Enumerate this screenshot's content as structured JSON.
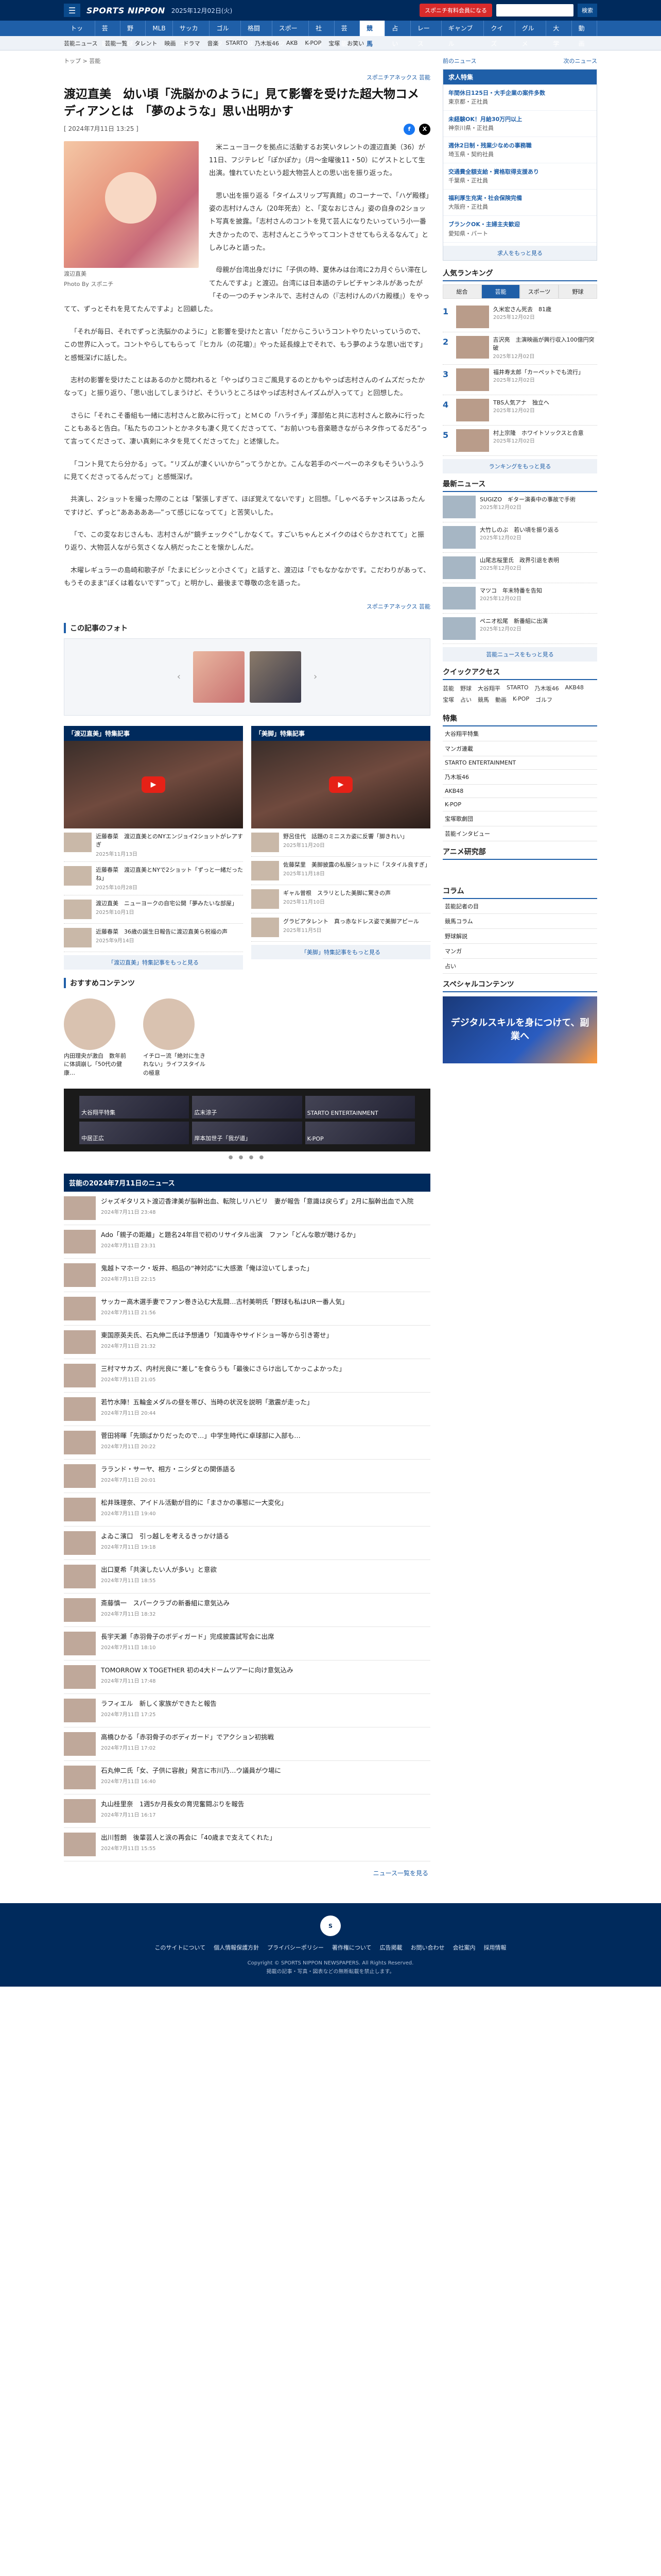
{
  "header": {
    "logo": "SPORTS NIPPON",
    "date": "2025年12月02日(火)",
    "register": "スポニチ有料会員になる",
    "search_btn": "検索"
  },
  "nav": [
    "トップ",
    "芸能",
    "野球",
    "MLB",
    "サッカー",
    "ゴルフ",
    "格闘技",
    "スポーツ",
    "社会",
    "芸能",
    "競馬",
    "占い",
    "レース",
    "ギャンブル",
    "クイズ",
    "グルメ",
    "大学",
    "動画"
  ],
  "subnav": [
    "芸能ニュース",
    "芸能一覧",
    "タレント",
    "映画",
    "ドラマ",
    "音楽",
    "STARTO",
    "乃木坂46",
    "AKB",
    "K-POP",
    "宝塚",
    "お笑い"
  ],
  "breadcrumb": "トップ > 芸能",
  "article": {
    "source": "スポニチアネックス 芸能",
    "title": "渡辺直美　幼い頃「洗脳かのように」見て影響を受けた超大物コメディアンとは　「夢のような」思い出明かす",
    "date": "[ 2024年7月11日 13:25 ]",
    "photo_caption": "渡辺直美",
    "photo_credit": "Photo By スポニチ",
    "paragraphs": [
      "米ニューヨークを拠点に活動するお笑いタレントの渡辺直美（36）が11日、フジテレビ「ぽかぽか」（月～金曜後11・50）にゲストとして生出演。憧れていたという超大物芸人との思い出を振り返った。",
      "思い出を振り返る「タイムスリップ写真館」のコーナーで、「ハゲ殿様」姿の志村けんさん（20年死去）と、「変なおじさん」姿の自身の2ショット写真を披露。「志村さんのコントを見て芸人になりたいっていう小一番大きかったので、志村さんとこうやってコントさせてもらえるなんて」としみじみと語った。",
      "母親が台湾出身だけに「子供の時、夏休みは台湾に2カ月ぐらい滞在してたんですよ」と渡辺。台湾には日本語のテレビチャンネルがあったが「その一つのチャンネルで、志村さんの（『志村けんのバカ殿様』）をやってて、ずっとそれを見てたんですよ」と回顧した。",
      "「それが毎日、それでずっと洗脳かのように」と影響を受けたと言い「だからこういうコントやりたいっていうので、この世界に入って。コントやらしてもらって『ヒカル（の花壇）』やった延長線上でそれで、もう夢のような思い出です」と感慨深げに話した。",
      "志村の影響を受けたことはあるのかと問われると「やっぱりコミご風見するのとかもやっぱ志村さんのイムズだったかなって」と振り返り、「思い出してしまうけど、そういうところはやっぱ志村さんイズムが入ってて」と回想した。",
      "さらに「それこそ番組も一緒に志村さんと飲みに行って」とＭＣの「ハライチ」澤部佑と共に志村さんと飲みに行ったこともあると告白。「私たちのコントとかネタも凄く見てくださってて、“お前いつも音楽聴きながらネタ作ってるだろ”って言ってくださって、凄い真剣にネタを見てくださってた」と述懐した。",
      "「コント見てたら分かる」って。“リズムが凄くいいから”ってうかとか。こんな若手のペーペーのネタもそういうふうに見てくださってるんだって」と感慨深げ。",
      "共演し、2ショットを撮った際のことは「緊張しすぎて、ほぼ覚えてないです」と回想。「しゃべるチャンスはあったんですけど、ずっと“あああああ―”って感じになってて」と苦笑いした。",
      "「で、この変なおじさんも、志村さんが“鏡チェックぐ”しかなくて。すごいちゃんとメイクのはぐらかされてて」と振り返り、大物芸人ながら気さくな人柄だったことを懐かしんだ。",
      "木曜レギュラーの島崎和歌子が「たまにビシッと小さくて」と話すと、渡辺は「でもなかなかです。こだわりがあって、もうそのまま“ぼくは着ないです”って」と明かし、最後まで尊敬の念を語った。"
    ],
    "footer_source": "スポニチアネックス 芸能"
  },
  "gallery": {
    "title": "この記事のフォト"
  },
  "twocol": [
    {
      "head": "「渡辺直美」特集記事",
      "items": [
        {
          "title": "近藤春菜　渡辺直美とのNYエンジョイ2ショットがレアすぎ",
          "date": "2025年11月13日"
        },
        {
          "title": "近藤春菜　渡辺直美とNYで2ショット「ずっと一緒だったね」",
          "date": "2025年10月28日"
        },
        {
          "title": "渡辺直美　ニューヨークの自宅公開「夢みたいな部屋」",
          "date": "2025年10月1日"
        },
        {
          "title": "近藤春菜　36歳の誕生日報告に渡辺直美ら祝福の声",
          "date": "2025年9月14日"
        }
      ],
      "more": "「渡辺直美」特集記事をもっと見る"
    },
    {
      "head": "「美脚」特集記事",
      "items": [
        {
          "title": "野呂佳代　話題のミニスカ姿に反響「脚きれい」",
          "date": "2025年11月20日"
        },
        {
          "title": "佐藤栞里　美脚披露の私服ショットに「スタイル良すぎ」",
          "date": "2025年11月18日"
        },
        {
          "title": "ギャル曽根　スラリとした美脚に驚きの声",
          "date": "2025年11月10日"
        },
        {
          "title": "グラビアタレント　真っ赤なドレス姿で美脚アピール",
          "date": "2025年11月5日"
        }
      ],
      "more": "「美脚」特集記事をもっと見る"
    }
  ],
  "recommend": {
    "title": "おすすめコンテンツ",
    "items": [
      {
        "title": "内田理央が激白　数年前に体調崩し「50代の健康…"
      },
      {
        "title": "イチロー流「絶対に生きれない」ライフスタイルの極意"
      }
    ]
  },
  "carousel": [
    {
      "label": "大谷翔平特集"
    },
    {
      "label": "広末涼子"
    },
    {
      "label": "STARTO ENTERTAINMENT"
    },
    {
      "label": "中居正広"
    },
    {
      "label": "岸本加世子「我が道」"
    },
    {
      "label": "K-POP"
    }
  ],
  "list": {
    "title": "芸能の2024年7月11日のニュース",
    "items": [
      {
        "title": "ジャズギタリスト渡辺香津美が脳幹出血、転院しリハビリ　妻が報告「意識は戻らず」2月に脳幹出血で入院",
        "date": "2024年7月11日 23:48"
      },
      {
        "title": "Ado「親子の距離」と題名24年目で初のリサイタル出演　ファン「どんな歌が聴けるか」",
        "date": "2024年7月11日 23:31"
      },
      {
        "title": "鬼越トマホーク・坂井、相品の“神対応”に大感激「俺は泣いてしまった」",
        "date": "2024年7月11日 22:15"
      },
      {
        "title": "サッカー高木選手妻でファン巻き込む大乱闘…古村美明氏「野球も私はUR一番人気」",
        "date": "2024年7月11日 21:56"
      },
      {
        "title": "東国原英夫氏、石丸伸二氏は予想通り「知識寺やサイドショー等から引き寄せ」",
        "date": "2024年7月11日 21:32"
      },
      {
        "title": "三村マサカズ、内村光良に“差し”を食らうも「最後にさらけ出してかっこよかった」",
        "date": "2024年7月11日 21:05"
      },
      {
        "title": "若竹水陣！五輪金メダルの昼を帯び、当時の状況を説明「激震が走った」",
        "date": "2024年7月11日 20:44"
      },
      {
        "title": "菅田将暉「先頭ばかりだったので…」中学生時代に卓球部に入部も…",
        "date": "2024年7月11日 20:22"
      },
      {
        "title": "ラランド・サーヤ、相方・ニシダとの関係語る",
        "date": "2024年7月11日 20:01"
      },
      {
        "title": "松井珠理奈、アイドル活動が目的に「まさかの事態に一大変化」",
        "date": "2024年7月11日 19:40"
      },
      {
        "title": "よゐこ濱口　引っ越しを考えるきっかけ語る",
        "date": "2024年7月11日 19:18"
      },
      {
        "title": "出口夏希「共演したい人が多い」と意欲",
        "date": "2024年7月11日 18:55"
      },
      {
        "title": "斎藤慎一　スパークラブの新番組に意気込み",
        "date": "2024年7月11日 18:32"
      },
      {
        "title": "長宇天瀬「赤羽骨子のボディガード」完成披露試写会に出席",
        "date": "2024年7月11日 18:10"
      },
      {
        "title": "TOMORROW X TOGETHER 初の4大ドームツアーに向け意気込み",
        "date": "2024年7月11日 17:48"
      },
      {
        "title": "ラフィエル　新しく家族ができたと報告",
        "date": "2024年7月11日 17:25"
      },
      {
        "title": "高橋ひかる「赤羽骨子のボディガード」でアクション初挑戦",
        "date": "2024年7月11日 17:02"
      },
      {
        "title": "石丸伸二氏「女、子供に容赦」発言に市川乃…ウ議員がウ場に",
        "date": "2024年7月11日 16:40"
      },
      {
        "title": "丸山桂里奈　1週5か月長女の育児奮闘ぶりを報告",
        "date": "2024年7月11日 16:17"
      },
      {
        "title": "出川哲朗　後輩芸人と涙の再会に「40歳まで支えてくれた」",
        "date": "2024年7月11日 15:55"
      }
    ],
    "more": "ニュース一覧を見る"
  },
  "sidebar": {
    "top_links": [
      "前のニュース",
      "次のニュース"
    ],
    "jobs_head": "求人特集",
    "jobs": [
      {
        "title": "年間休日125日・大手企業の案件多数",
        "meta": "東京都・正社員"
      },
      {
        "title": "未経験OK！月給30万円以上",
        "meta": "神奈川県・正社員"
      },
      {
        "title": "週休2日制・残業少なめの事務職",
        "meta": "埼玉県・契約社員"
      },
      {
        "title": "交通費全額支給・資格取得支援あり",
        "meta": "千葉県・正社員"
      },
      {
        "title": "福利厚生充実・社会保険完備",
        "meta": "大阪府・正社員"
      },
      {
        "title": "ブランクOK・主婦主夫歓迎",
        "meta": "愛知県・パート"
      }
    ],
    "jobs_more": "求人をもっと見る",
    "ranking_head": "人気ランキング",
    "ranking_tabs": [
      "総合",
      "芸能",
      "スポーツ",
      "野球"
    ],
    "ranking": [
      {
        "title": "久米宏さん死去　81歳",
        "date": "2025年12月02日"
      },
      {
        "title": "吉沢亮　主演映画が興行収入100億円突破",
        "date": "2025年12月02日"
      },
      {
        "title": "福井寿太郎「カーペットでも流行」",
        "date": "2025年12月02日"
      },
      {
        "title": "TBS人気アナ　独立へ",
        "date": "2025年12月02日"
      },
      {
        "title": "村上宗隆　ホワイトソックスと合意",
        "date": "2025年12月02日"
      }
    ],
    "ranking_more": "ランキングをもっと見る",
    "news_head": "最新ニュース",
    "news": [
      {
        "title": "SUGIZO　ギター演奏中の事故で手術",
        "date": "2025年12月02日"
      },
      {
        "title": "大竹しのぶ　若い頃を振り返る",
        "date": "2025年12月02日"
      },
      {
        "title": "山尾志桜里氏　政界引退を表明",
        "date": "2025年12月02日"
      },
      {
        "title": "マツコ　年末特番を告知",
        "date": "2025年12月02日"
      },
      {
        "title": "ペニオ松尾　新番組に出演",
        "date": "2025年12月02日"
      }
    ],
    "news_more": "芸能ニュースをもっと見る",
    "quick_head": "クイックアクセス",
    "quick_links": [
      "芸能",
      "野球",
      "大谷翔平",
      "STARTO",
      "乃木坂46",
      "AKB48",
      "宝塚",
      "占い",
      "競馬",
      "動画",
      "K-POP",
      "ゴルフ"
    ],
    "feature_head": "特集",
    "features": [
      "大谷翔平特集",
      "マンガ連載",
      "STARTO ENTERTAINMENT",
      "乃木坂46",
      "AKB48",
      "K-POP",
      "宝塚歌劇団",
      "芸能インタビュー"
    ],
    "anime_head": "アニメ研究部",
    "column_head": "コラム",
    "columns": [
      "芸能記者の目",
      "競馬コラム",
      "野球解説",
      "マンガ",
      "占い"
    ],
    "special_head": "スペシャルコンテンツ",
    "banner": "デジタルスキルを身につけて、副業へ"
  },
  "footer": {
    "links": [
      "このサイトについて",
      "個人情報保護方針",
      "プライバシーポリシー",
      "著作権について",
      "広告掲載",
      "お問い合わせ",
      "会社案内",
      "採用情報"
    ],
    "copyright": "Copyright © SPORTS NIPPON NEWSPAPERS. All Rights Reserved.",
    "note": "掲載の記事・写真・図表などの無断転載を禁止します。"
  }
}
